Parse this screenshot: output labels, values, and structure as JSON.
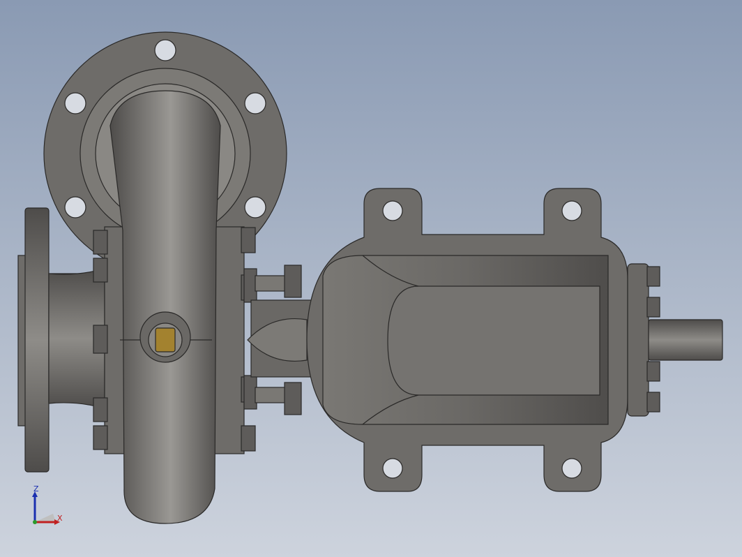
{
  "viewport": {
    "background_top": "#8a9ab3",
    "background_bottom": "#cdd3dd",
    "model_fill": "#6e6c69",
    "model_edge": "#2a2928",
    "model_highlight": "#9a9894",
    "bushing_color": "#a3822f"
  },
  "triad": {
    "x_label": "X",
    "z_label": "Z",
    "x_color": "#c02020",
    "z_color": "#1a2fb0",
    "y_color": "#2a9a2a"
  }
}
